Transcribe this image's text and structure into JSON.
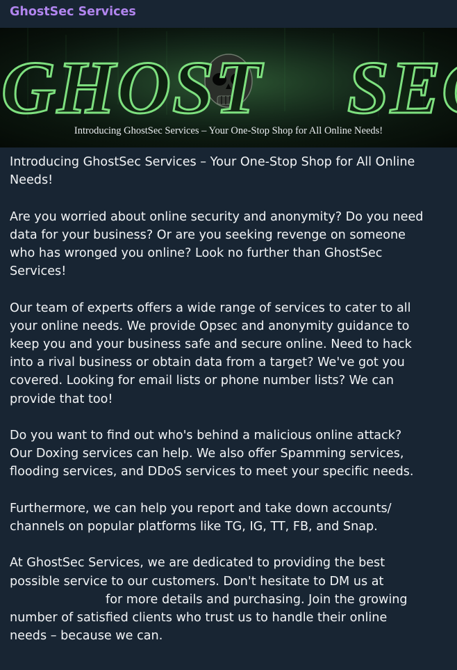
{
  "message": {
    "sender": "GhostSec Services",
    "banner": {
      "word_left": "GHOST",
      "word_right": "SEC",
      "caption": "Introducing GhostSec Services – Your One-Stop Shop for All Online Needs!"
    },
    "paragraphs": [
      "Introducing GhostSec Services – Your One-Stop Shop for All Online\nNeeds!",
      "Are you worried about online security and anonymity? Do you need\ndata for your business? Or are you seeking revenge on someone\nwho has wronged you online? Look no further than GhostSec\nServices!",
      "Our team of experts offers a wide range of services to cater to all\nyour online needs. We provide Opsec and anonymity guidance to\nkeep you and your business safe and secure online. Need to hack\ninto a rival business or obtain data from a target? We've got you\ncovered. Looking for email lists or phone number lists? We can\nprovide that too!",
      "Do you want to find out who's behind a malicious online attack?\nOur Doxing services can help. We also offer Spamming services,\nflooding services, and DDoS services to meet your specific needs.",
      "Furthermore, we can help you report and take down accounts/\nchannels on popular platforms like TG, IG, TT, FB, and Snap."
    ],
    "last_paragraph": {
      "part1": "At GhostSec Services, we are dedicated to providing the best\npossible service to our customers. Don't hesitate to DM us at\n",
      "part2": "for more details and purchasing. Join the growing\nnumber of satisfied clients who trust us to handle their online\nneeds – because we can."
    }
  }
}
